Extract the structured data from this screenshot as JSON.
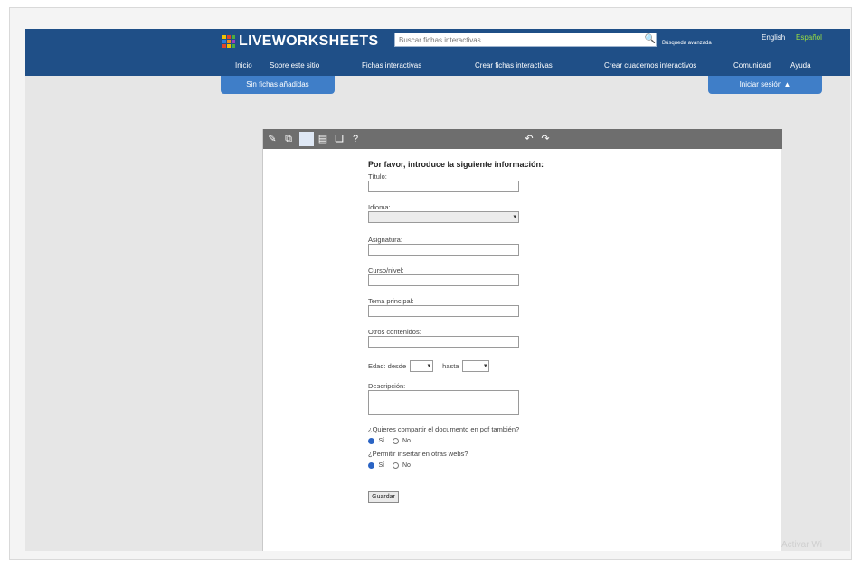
{
  "brand": {
    "name": "LIVEWORKSHEETS",
    "logo_colors": [
      "#f2c200",
      "#e0452b",
      "#4cae3f",
      "#2e7cd6",
      "#f28c1a",
      "#9b3fbf",
      "#e0452b",
      "#f2c200",
      "#4cae3f"
    ]
  },
  "header": {
    "search_placeholder": "Buscar fichas interactivas",
    "search_icon": "magnifier-icon",
    "advanced_search": "Búsqueda avanzada",
    "lang_english": "English",
    "lang_spanish": "Español",
    "accent_color": "#1f4f87"
  },
  "nav": {
    "items": [
      "Inicio",
      "Sobre este sitio",
      "Fichas interactivas",
      "Crear fichas interactivas",
      "Crear cuadernos interactivos",
      "Comunidad",
      "Ayuda"
    ]
  },
  "tabs": {
    "left": "Sin fichas añadidas",
    "right": "Iniciar sesión ▲"
  },
  "toolbar": {
    "icons": [
      "edit-icon",
      "copy-icon",
      "blank-page-icon",
      "document-icon",
      "pages-icon",
      "help-icon",
      "undo-icon",
      "redo-icon"
    ],
    "help": "?",
    "undo": "↶",
    "redo": "↷"
  },
  "form": {
    "title": "Por favor, introduce la siguiente información:",
    "title_field_label": "Título:",
    "language_label": "Idioma:",
    "subject_label": "Asignatura:",
    "grade_label": "Curso/nivel:",
    "main_topic_label": "Tema principal:",
    "other_contents_label": "Otros contenidos:",
    "age_from_label": "Edad: desde",
    "age_to_label": "hasta",
    "description_label": "Descripción:",
    "share_pdf_question": "¿Quieres compartir el documento en pdf también?",
    "keep_private_question": "¿Permitir insertar en otras webs?",
    "yes": "Sí",
    "no": "No",
    "send_button": "Guardar"
  },
  "watermark": "Activar Wi"
}
